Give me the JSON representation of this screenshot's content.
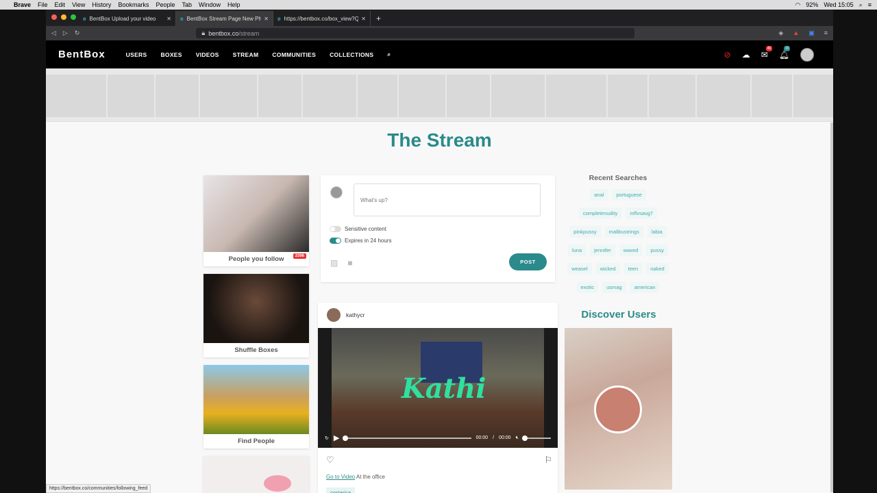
{
  "os_menubar": {
    "app": "Brave",
    "items": [
      "File",
      "Edit",
      "View",
      "History",
      "Bookmarks",
      "People",
      "Tab",
      "Window",
      "Help"
    ],
    "battery": "92%",
    "clock": "Wed 15:05"
  },
  "browser": {
    "tabs": [
      {
        "title": "BentBox Upload your video",
        "active": false
      },
      {
        "title": "BentBox Stream Page New Photo",
        "active": true
      },
      {
        "title": "https://bentbox.co/box_view?Qd",
        "active": false
      }
    ],
    "url_host": "bentbox.co",
    "url_path": "/stream",
    "status_url": "https://bentbox.co/communities/following_feed"
  },
  "site": {
    "logo": "BentBox",
    "nav": [
      "USERS",
      "BOXES",
      "VIDEOS",
      "STREAM",
      "COMMUNITIES",
      "COLLECTIONS"
    ],
    "msg_badge": "46",
    "notif_badge": "15",
    "page_title": "The Stream",
    "left_cards": [
      {
        "label": "People you follow",
        "count": "3396"
      },
      {
        "label": "Shuffle Boxes"
      },
      {
        "label": "Find People"
      }
    ],
    "composer": {
      "placeholder": "What's up?",
      "sensitive_label": "Sensitive content",
      "expires_label": "Expires in 24 hours",
      "post_label": "POST"
    },
    "post": {
      "username": "kathycr",
      "video_title": "Kathi",
      "time_current": "00:00",
      "time_sep": "/",
      "time_total": "00:00",
      "link_text": "Go to Video",
      "caption": "At the office",
      "tag": "costarica"
    },
    "recent_searches": {
      "title": "Recent Searches",
      "chips": [
        "anal",
        "portuguese",
        "completenudity",
        "mflvsavg7",
        "pinkpussy",
        "malibustrings",
        "labia",
        "luna",
        "jennifer",
        "waxed",
        "pussy",
        "weasel",
        "wicked",
        "teen",
        "naked",
        "exotic",
        "usmag",
        "american"
      ]
    },
    "discover_title": "Discover Users"
  },
  "colors": {
    "accent": "#2a8a8a",
    "post_button": "#2b8a8c",
    "nav_bg": "#000000"
  }
}
